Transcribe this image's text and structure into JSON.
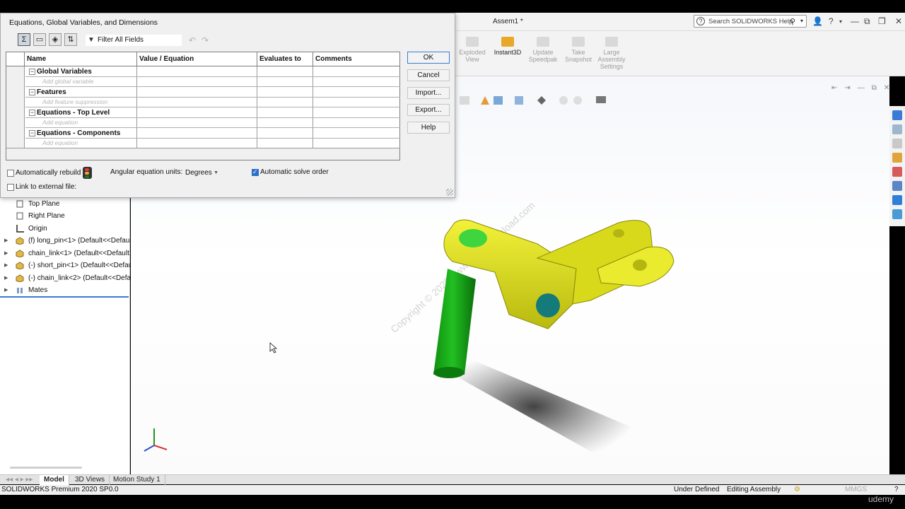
{
  "window": {
    "doc_title": "Assem1 *",
    "search_placeholder": "Search SOLIDWORKS Help"
  },
  "command_bar": {
    "items": [
      {
        "label_1": "Exploded",
        "label_2": "View",
        "enabled": false
      },
      {
        "label_1": "Instant3D",
        "label_2": "",
        "enabled": true
      },
      {
        "label_1": "Update",
        "label_2": "Speedpak",
        "enabled": false
      },
      {
        "label_1": "Take",
        "label_2": "Snapshot",
        "enabled": false
      },
      {
        "label_1": "Large",
        "label_2": "Assembly",
        "label_3": "Settings",
        "enabled": false
      }
    ]
  },
  "dialog": {
    "title": "Equations, Global Variables, and Dimensions",
    "filter_label": "Filter All Fields",
    "columns": [
      "Name",
      "Value / Equation",
      "Evaluates to",
      "Comments"
    ],
    "sections": [
      {
        "title": "Global Variables",
        "add_placeholder": "Add global variable"
      },
      {
        "title": "Features",
        "add_placeholder": "Add feature suppression"
      },
      {
        "title": "Equations - Top Level",
        "add_placeholder": "Add equation"
      },
      {
        "title": "Equations - Components",
        "add_placeholder": "Add equation"
      }
    ],
    "buttons": {
      "ok": "OK",
      "cancel": "Cancel",
      "import": "Import...",
      "export": "Export...",
      "help": "Help"
    },
    "options": {
      "auto_rebuild_label": "Automatically rebuild",
      "auto_rebuild_checked": false,
      "angular_units_label": "Angular equation units:",
      "angular_units_value": "Degrees",
      "auto_solve_label": "Automatic solve order",
      "auto_solve_checked": true,
      "link_external_label": "Link to external file:",
      "link_external_checked": false
    }
  },
  "feature_tree": {
    "items": [
      {
        "label": "Top Plane",
        "icon": "plane-icon",
        "expandable": false
      },
      {
        "label": "Right Plane",
        "icon": "plane-icon",
        "expandable": false
      },
      {
        "label": "Origin",
        "icon": "origin-icon",
        "expandable": false
      },
      {
        "label": "(f) long_pin<1> (Default<<Defaul",
        "icon": "part-icon",
        "expandable": true
      },
      {
        "label": "chain_link<1> (Default<<Default:",
        "icon": "part-icon",
        "expandable": true
      },
      {
        "label": "(-) short_pin<1> (Default<<Defau",
        "icon": "part-icon",
        "expandable": true
      },
      {
        "label": "(-) chain_link<2> (Default<<Defa",
        "icon": "part-icon",
        "expandable": true
      },
      {
        "label": "Mates",
        "icon": "mates-icon",
        "expandable": true
      }
    ]
  },
  "viewport": {
    "watermark": "Copyright © 2025 - www.p30download.com"
  },
  "tabs": [
    "Model",
    "3D Views",
    "Motion Study 1"
  ],
  "status": {
    "product": "SOLIDWORKS Premium 2020 SP0.0",
    "state": "Under Defined",
    "mode": "Editing Assembly",
    "units": "MMGS"
  },
  "branding": "udemy",
  "colors": {
    "part_yellow": "#e4e419",
    "pin_green": "#1fb41f",
    "accent_blue": "#2a6fc9"
  }
}
